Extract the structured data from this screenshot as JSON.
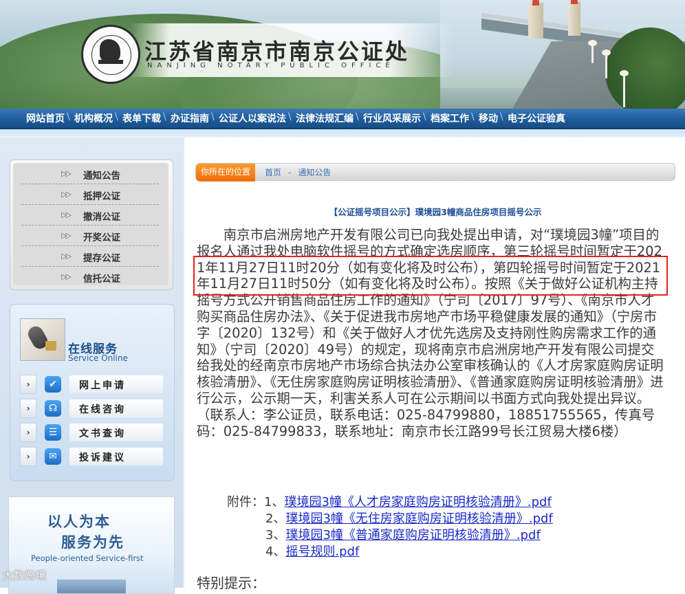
{
  "header": {
    "title": "江苏省南京市南京公证处",
    "subtitle": "NANJING NOTARY PUBLIC OFFICE",
    "seal_text": "NANJING NOTARY PUBLIC OFFICE 南京公证处"
  },
  "nav": {
    "items": [
      "网站首页",
      "机构概况",
      "表单下载",
      "办证指南",
      "公证人以案说法",
      "法律法规汇编",
      "行业风采展示",
      "档案工作",
      "移动",
      "电子公证验真"
    ]
  },
  "sidebar": {
    "notices": [
      "通知公告",
      "抵押公证",
      "撤消公证",
      "开奖公证",
      "提存公证",
      "信托公证"
    ],
    "service": {
      "title": "在线服务",
      "subtitle": "Service Online",
      "items": [
        {
          "label": "网上申请",
          "icon": "checklist-icon"
        },
        {
          "label": "在线咨询",
          "icon": "headset-icon"
        },
        {
          "label": "文书查询",
          "icon": "list-icon"
        },
        {
          "label": "投诉建议",
          "icon": "chat-icon"
        }
      ]
    },
    "ad": {
      "line1": "以人为本",
      "line2": "服务为先",
      "english": "People-oriented  Service-first"
    },
    "watermark": "大数跨境"
  },
  "breadcrumb": {
    "tag": "你所在的位置",
    "home": "首页",
    "separator": "-",
    "current": "通知公告"
  },
  "article": {
    "title": "【公证摇号项目公示】璞境园3幢商品住房项目摇号公示",
    "body": "南京市启洲房地产开发有限公司已向我处提出申请，对“璞境园3幢”项目的报名人通过我处电脑软件摇号的方式确定选房顺序，第三轮摇号时间暂定于2021年11月27日11时20分（如有变化将及时公布），第四轮摇号时间暂定于2021年11月27日11时50分（如有变化将及时公布）。按照《关于做好公证机构主持摇号方式公开销售商品住房工作的通知》（宁司〔2017〕97号）、《南京市人才购买商品住房办法》、《关于促进我市房地产市场平稳健康发展的通知》（宁房市字〔2020〕132号）和《关于做好人才优先选房及支持刚性购房需求工作的通知》（宁司〔2020〕49号）的规定，现将南京市启洲房地产开发有限公司提交给我处的经南京市房地产市场综合执法办公室审核确认的《人才房家庭购房证明核验清册》、《无住房家庭购房证明核验清册》、《普通家庭购房证明核验清册》进行公示，公示期一天，利害关系人可在公示期间以书面方式向我处提出异议。（联系人：李公证员，联系电话：025-84799880，18851755565，传真号码：025-84799833，联系地址：南京市长江路99号长江贸易大楼6楼）",
    "attachments_label": "附件：",
    "attachments": [
      {
        "num": "1、",
        "name": "璞境园3幢《人才房家庭购房证明核验清册》.pdf"
      },
      {
        "num": "2、",
        "name": "璞境园3幢《无住房家庭购房证明核验清册》.pdf"
      },
      {
        "num": "3、",
        "name": "璞境园3幢《普通家庭购房证明核验清册》.pdf"
      },
      {
        "num": "4、",
        "name": "摇号规则.pdf"
      }
    ],
    "special_title": "特别提示："
  },
  "colors": {
    "nav_blue": "#1e5c9c",
    "link_blue": "#1a29c9",
    "title_blue": "#1c4f94",
    "highlight_red": "#e2231a",
    "crumb_orange": "#f06d08"
  }
}
